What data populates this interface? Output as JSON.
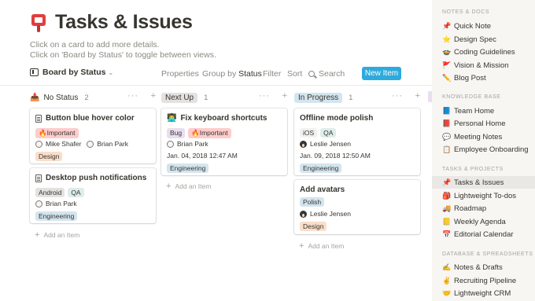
{
  "page": {
    "title": "Tasks & Issues",
    "icon": "pushpin-red-icon",
    "subtitle_1": "Click on a card to add more details.",
    "subtitle_2": "Click on 'Board by Status' to toggle between views."
  },
  "toolbar": {
    "view_label": "Board by Status",
    "properties": "Properties",
    "group_by_prefix": "Group by",
    "group_by_value": "Status",
    "filter": "Filter",
    "sort": "Sort",
    "search": "Search",
    "new_item": "New Item",
    "new_item_color": "#2eaadc"
  },
  "columns": [
    {
      "label": "No Status",
      "count": "2",
      "more": "···",
      "plus": "+",
      "cards": [
        {
          "title": "Button blue hover color",
          "tags": [
            "🔥Important"
          ],
          "people": [
            "Mike Shafer",
            "Brian Park"
          ],
          "tags2": [
            "Design"
          ]
        },
        {
          "title": "Desktop push notifications",
          "tags": [
            "Android",
            "QA"
          ],
          "people": [
            "Brian Park"
          ],
          "tags2": [
            "Engineering"
          ]
        }
      ],
      "add_item": "Add an Item"
    },
    {
      "label": "Next Up",
      "count": "1",
      "more": "···",
      "plus": "+",
      "label_color": "#e3e2e0",
      "cards": [
        {
          "title": "Fix keyboard shortcuts",
          "title_icon": "technologist-emoji",
          "tags": [
            "Bug",
            "🔥Important"
          ],
          "people": [
            "Brian Park"
          ],
          "date": "Jan. 04, 2018 12:47 AM",
          "tags2": [
            "Engineering"
          ]
        }
      ],
      "add_item": "Add an Item"
    },
    {
      "label": "In Progress",
      "count": "1",
      "more": "···",
      "plus": "+",
      "label_color": "#d3e5ef",
      "cards": [
        {
          "title": "Offline mode polish",
          "tags": [
            "iOS",
            "QA"
          ],
          "people": [
            "Leslie Jensen"
          ],
          "date": "Jan. 09, 2018 12:50 AM",
          "tags2": [
            "Engineering"
          ]
        },
        {
          "title": "Add avatars",
          "tags": [
            "Polish"
          ],
          "people": [
            "Leslie Jensen"
          ],
          "tags2": [
            "Design"
          ]
        }
      ],
      "add_item": "Add an Item"
    }
  ],
  "sidebar": {
    "sections": [
      {
        "label": "NOTES & DOCS",
        "items": [
          {
            "label": "Quick Note",
            "icon": "📌"
          },
          {
            "label": "Design Spec",
            "icon": "⭐"
          },
          {
            "label": "Coding Guidelines",
            "icon": "🍲"
          },
          {
            "label": "Vision & Mission",
            "icon": "🚩"
          },
          {
            "label": "Blog Post",
            "icon": "✏️"
          }
        ]
      },
      {
        "label": "KNOWLEDGE BASE",
        "items": [
          {
            "label": "Team Home",
            "icon": "📘"
          },
          {
            "label": "Personal Home",
            "icon": "📕"
          },
          {
            "label": "Meeting Notes",
            "icon": "💬"
          },
          {
            "label": "Employee Onboarding",
            "icon": "📋"
          }
        ]
      },
      {
        "label": "TASKS & PROJECTS",
        "items": [
          {
            "label": "Tasks & Issues",
            "icon": "📌",
            "active": true
          },
          {
            "label": "Lightweight To-dos",
            "icon": "🎒"
          },
          {
            "label": "Roadmap",
            "icon": "🚚"
          },
          {
            "label": "Weekly Agenda",
            "icon": "📒"
          },
          {
            "label": "Editorial Calendar",
            "icon": "📅"
          }
        ]
      },
      {
        "label": "DATABASE & SPREADSHEETS",
        "items": [
          {
            "label": "Notes & Drafts",
            "icon": "✍️"
          },
          {
            "label": "Recruiting Pipeline",
            "icon": "✌️"
          },
          {
            "label": "Lightweight CRM",
            "icon": "🤝"
          }
        ]
      }
    ]
  }
}
